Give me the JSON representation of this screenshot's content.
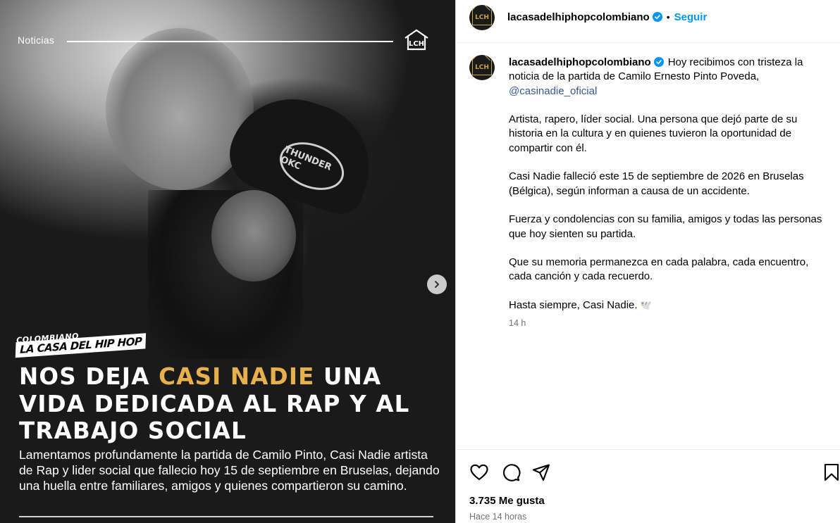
{
  "media": {
    "category": "Noticias",
    "stamp_top": "COLOMBIANO",
    "stamp_main": "LA CASA DEL HIP HOP",
    "cap_logo": "THUNDER OKC",
    "headline_before": "NOS DEJA ",
    "headline_highlight": "CASI NADIE",
    "headline_after": " UNA VIDA DEDICADA AL RAP Y AL TRABAJO SOCIAL",
    "summary": "Lamentamos profundamente la partida de Camilo Pinto, Casi Nadie artista de Rap y lider social que fallecio hoy 15 de septiembre en Bruselas, dejando una huella entre familiares, amigos y quienes compartieron su camino.",
    "next_icon": "chevron-right-icon",
    "brand_mark_text": "LCH",
    "accent_color": "#e7b04c"
  },
  "header": {
    "username": "lacasadelhiphopcolombiano",
    "separator": "•",
    "follow_label": "Seguir",
    "avatar_text": "LCH"
  },
  "caption": {
    "username": "lacasadelhiphopcolombiano",
    "intro": "Hoy recibimos con tristeza la noticia de la partida de Camilo Ernesto Pinto Poveda,",
    "mention": "@casinadie_oficial",
    "paragraphs": [
      "Artista, rapero, líder social. Una persona que dejó parte de su historia en la cultura y en quienes tuvieron la oportunidad de compartir con él.",
      "Casi Nadie falleció este 15 de septiembre de 2026 en Bruselas (Bélgica), según informan a causa de un accidente.",
      "Fuerza y condolencias con su familia, amigos y todas las personas que hoy sienten su partida.",
      "Que su memoria permanezca en cada palabra, cada encuentro, cada canción y cada recuerdo."
    ],
    "closing": "Hasta siempre, Casi Nadie.",
    "closing_emoji": "🕊️",
    "time": "14 h"
  },
  "actions": {
    "like_icon": "heart-icon",
    "comment_icon": "comment-icon",
    "share_icon": "share-icon",
    "save_icon": "bookmark-icon",
    "likes": "3.735 Me gusta",
    "posted": "Hace 14 horas"
  },
  "colors": {
    "link_blue": "#0095f6",
    "mention_blue": "#385898",
    "verified_blue": "#0095f6",
    "muted": "#737373"
  }
}
